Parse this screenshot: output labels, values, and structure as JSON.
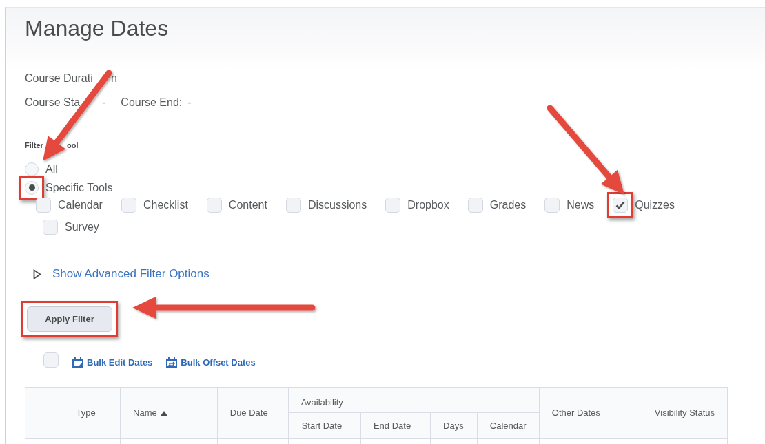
{
  "page": {
    "title": "Manage Dates"
  },
  "course": {
    "duration_label": [
      "Course Durati",
      "n"
    ],
    "start_label": "Course Sta",
    "start_value": "-",
    "end_label": "Course End:",
    "end_value": "-"
  },
  "filter": {
    "label": [
      "Filter",
      "ool"
    ],
    "options": [
      {
        "label": "All",
        "selected": false,
        "highlighted": false
      },
      {
        "label": "Specific Tools",
        "selected": true,
        "highlighted": true
      }
    ],
    "tools": [
      {
        "label": "Calendar",
        "checked": false,
        "highlighted": false
      },
      {
        "label": "Checklist",
        "checked": false,
        "highlighted": false
      },
      {
        "label": "Content",
        "checked": false,
        "highlighted": false
      },
      {
        "label": "Discussions",
        "checked": false,
        "highlighted": false
      },
      {
        "label": "Dropbox",
        "checked": false,
        "highlighted": false
      },
      {
        "label": "Grades",
        "checked": false,
        "highlighted": false
      },
      {
        "label": "News",
        "checked": false,
        "highlighted": false
      },
      {
        "label": "Quizzes",
        "checked": true,
        "highlighted": true
      },
      {
        "label": "Survey",
        "checked": false,
        "highlighted": false
      }
    ],
    "advanced_link": {
      "label": "Show Advanced Filter Options",
      "expanded": false
    },
    "apply_button": {
      "label": "Apply Filter",
      "highlighted": true
    }
  },
  "toolbar": {
    "select_all_checked": false,
    "actions": [
      {
        "label": "Bulk Edit Dates",
        "kind": "edit"
      },
      {
        "label": "Bulk Offset Dates",
        "kind": "offset"
      }
    ]
  },
  "table": {
    "columns": [
      {
        "kind": "single",
        "label": "Type"
      },
      {
        "kind": "single",
        "label": "Name",
        "sorted_ascending": true
      },
      {
        "kind": "single",
        "label": "Due Date"
      },
      {
        "kind": "group",
        "label": "Availability",
        "children": [
          "Start Date",
          "End Date",
          "Days",
          "Calendar"
        ]
      },
      {
        "kind": "single",
        "label": "Other Dates"
      },
      {
        "kind": "single",
        "label": "Visibility Status"
      }
    ]
  }
}
